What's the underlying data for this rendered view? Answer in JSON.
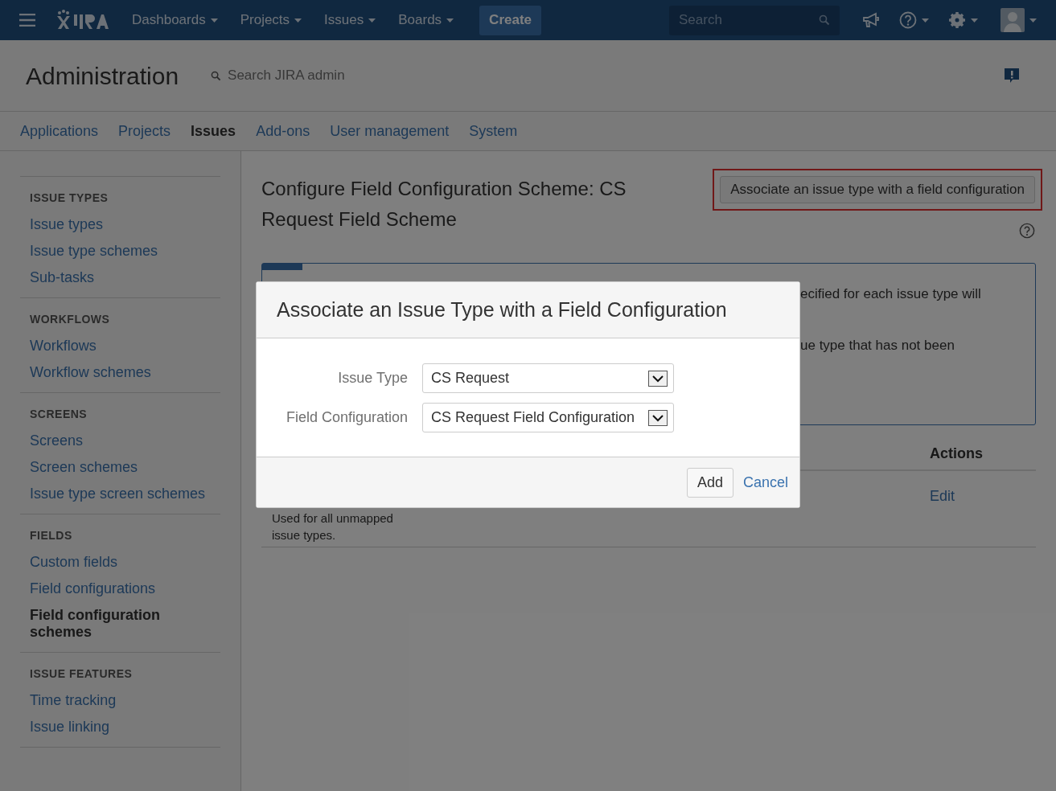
{
  "topbar": {
    "menus": [
      {
        "label": "Dashboards"
      },
      {
        "label": "Projects"
      },
      {
        "label": "Issues"
      },
      {
        "label": "Boards"
      }
    ],
    "create": "Create",
    "search": {
      "placeholder": "Search"
    }
  },
  "admin": {
    "title": "Administration",
    "search": {
      "placeholder": "Search JIRA admin"
    }
  },
  "tabs": [
    {
      "label": "Applications",
      "selected": false
    },
    {
      "label": "Projects",
      "selected": false
    },
    {
      "label": "Issues",
      "selected": true
    },
    {
      "label": "Add-ons",
      "selected": false
    },
    {
      "label": "User management",
      "selected": false
    },
    {
      "label": "System",
      "selected": false
    }
  ],
  "sidebar": {
    "sections": [
      {
        "heading": "ISSUE TYPES",
        "items": [
          {
            "label": "Issue types",
            "selected": false
          },
          {
            "label": "Issue type schemes",
            "selected": false
          },
          {
            "label": "Sub-tasks",
            "selected": false
          }
        ]
      },
      {
        "heading": "WORKFLOWS",
        "items": [
          {
            "label": "Workflows",
            "selected": false
          },
          {
            "label": "Workflow schemes",
            "selected": false
          }
        ]
      },
      {
        "heading": "SCREENS",
        "items": [
          {
            "label": "Screens",
            "selected": false
          },
          {
            "label": "Screen schemes",
            "selected": false
          },
          {
            "label": "Issue type screen schemes",
            "selected": false
          }
        ]
      },
      {
        "heading": "FIELDS",
        "items": [
          {
            "label": "Custom fields",
            "selected": false
          },
          {
            "label": "Field configurations",
            "selected": false
          },
          {
            "label": "Field configuration schemes",
            "selected": true
          }
        ]
      },
      {
        "heading": "ISSUE FEATURES",
        "items": [
          {
            "label": "Time tracking",
            "selected": false
          },
          {
            "label": "Issue linking",
            "selected": false
          }
        ]
      }
    ]
  },
  "content": {
    "title": "Configure Field Configuration Scheme: CS Request Field Scheme",
    "associate_button": "Associate an issue type with a field configuration",
    "info_lines": [
      "ecified for each issue type will",
      "ue type that has not been"
    ],
    "table": {
      "header": "Actions",
      "row": {
        "description": "Used for all unmapped issue types.",
        "action": "Edit"
      }
    }
  },
  "dialog": {
    "title": "Associate an Issue Type with a Field Configuration",
    "fields": [
      {
        "label": "Issue Type",
        "value": "CS Request"
      },
      {
        "label": "Field Configuration",
        "value": "CS Request Field Configuration"
      }
    ],
    "add": "Add",
    "cancel": "Cancel"
  }
}
